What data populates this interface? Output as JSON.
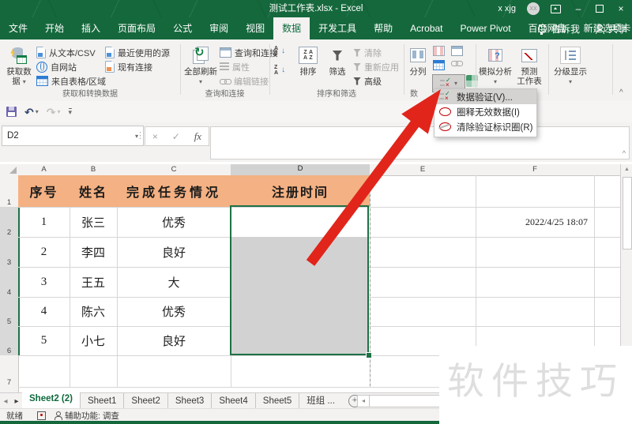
{
  "window": {
    "title": "测试工作表.xlsx - Excel",
    "user_label": "x xjg",
    "avatar_initials": "XX"
  },
  "ribbon_tabs": [
    "文件",
    "开始",
    "插入",
    "页面布局",
    "公式",
    "审阅",
    "视图",
    "数据",
    "开发工具",
    "帮助",
    "Acrobat",
    "Power Pivot",
    "百度网盘",
    "新建选项卡"
  ],
  "tab_actions": {
    "tell_me": "告诉我",
    "share": "共享"
  },
  "ribbon": {
    "get_group": {
      "label": "获取和转换数据",
      "big_line1": "获取数",
      "big_line2": "据",
      "items": [
        "从文本/CSV",
        "自网站",
        "来自表格/区域",
        "最近使用的源",
        "现有连接"
      ]
    },
    "query_group": {
      "label": "查询和连接",
      "big": "全部刷新",
      "items": [
        "查询和连接",
        "属性",
        "编辑链接"
      ]
    },
    "sort_group": {
      "label": "排序和筛选",
      "sort": "排序",
      "filter": "筛选",
      "items": [
        "清除",
        "重新应用",
        "高级"
      ]
    },
    "tools_group": {
      "label_partial": "数",
      "big": "分列"
    },
    "forecast_group": {
      "what_if": "模拟分析",
      "forecast_line1": "预测",
      "forecast_line2": "工作表"
    },
    "outline_group": {
      "big": "分级显示"
    }
  },
  "validation_menu": [
    "数据验证(V)...",
    "圈释无效数据(I)",
    "清除验证标识圈(R)"
  ],
  "formula_bar": {
    "name_box": "D2",
    "formula_value": ""
  },
  "sheet": {
    "col_headers": [
      "A",
      "B",
      "C",
      "D",
      "E",
      "F"
    ],
    "row_headers": [
      "1",
      "2",
      "3",
      "4",
      "5",
      "6",
      "7"
    ],
    "header_row": {
      "a": "序号",
      "b": "姓名",
      "c": "完成任务情况",
      "d": "注册时间"
    },
    "rows": [
      {
        "no": "1",
        "name": "张三",
        "status": "优秀"
      },
      {
        "no": "2",
        "name": "李四",
        "status": "良好"
      },
      {
        "no": "3",
        "name": "王五",
        "status": "大"
      },
      {
        "no": "4",
        "name": "陈六",
        "status": "优秀"
      },
      {
        "no": "5",
        "name": "小七",
        "status": "良好"
      }
    ],
    "f2_value": "2022/4/25 18:07"
  },
  "sheet_tabs": {
    "active": "Sheet2 (2)",
    "others": [
      "Sheet1",
      "Sheet2",
      "Sheet3",
      "Sheet4",
      "Sheet5",
      "班组 ..."
    ]
  },
  "status_bar": {
    "mode": "就绪",
    "accessibility": "辅助功能: 调查"
  },
  "watermark": "软件技巧",
  "glyphs": {
    "dropdown": "▾",
    "undo": "↶",
    "redo": "↷",
    "overflow": "⋮",
    "cancel": "×",
    "confirm": "✓",
    "fx": "fx",
    "collapse": "^",
    "up": "▲",
    "left_small": "◂",
    "right_small": "▸",
    "add": "+",
    "refresh": "↻",
    "question": "?",
    "arrow_down": "↓",
    "letter_a": "A",
    "letter_z": "Z",
    "minimize": "–",
    "close": "×",
    "check": "✓",
    "cross": "×"
  },
  "colors": {
    "excel_green": "#15683C",
    "header_fill": "#F4B183",
    "selection_fill": "#D2D2D2",
    "selection_border": "#1E7145",
    "arrow_red": "#E1251B"
  }
}
